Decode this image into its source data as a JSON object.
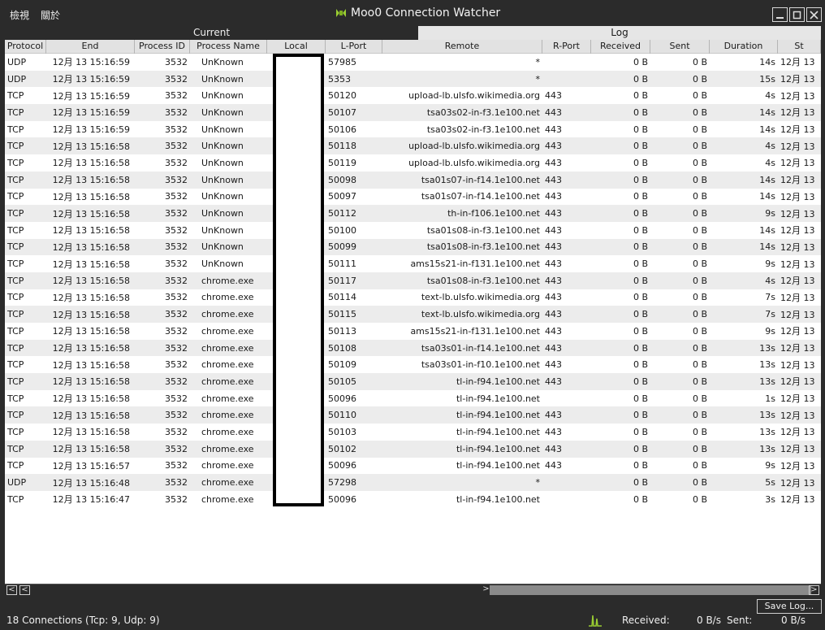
{
  "menu": {
    "view": "檢視",
    "about": "關於"
  },
  "window": {
    "title": "Moo0 Connection Watcher"
  },
  "tabs": {
    "current": "Current",
    "log": "Log"
  },
  "columns": [
    "Protocol",
    "End",
    "Process ID",
    "Process Name",
    "Local",
    "L-Port",
    "Remote",
    "R-Port",
    "Received",
    "Sent",
    "Duration",
    "St"
  ],
  "rows": [
    [
      "UDP",
      "12月 13  15:16:59",
      "3532",
      "UnKnown",
      "",
      "57985",
      "*",
      "",
      "0 B",
      "0 B",
      "14s",
      "12月 13"
    ],
    [
      "UDP",
      "12月 13  15:16:59",
      "3532",
      "UnKnown",
      "",
      "5353",
      "*",
      "",
      "0 B",
      "0 B",
      "15s",
      "12月 13"
    ],
    [
      "TCP",
      "12月 13  15:16:59",
      "3532",
      "UnKnown",
      "",
      "50120",
      "upload-lb.ulsfo.wikimedia.org",
      "443",
      "0 B",
      "0 B",
      "4s",
      "12月 13"
    ],
    [
      "TCP",
      "12月 13  15:16:59",
      "3532",
      "UnKnown",
      "",
      "50107",
      "tsa03s02-in-f3.1e100.net",
      "443",
      "0 B",
      "0 B",
      "14s",
      "12月 13"
    ],
    [
      "TCP",
      "12月 13  15:16:59",
      "3532",
      "UnKnown",
      "",
      "50106",
      "tsa03s02-in-f3.1e100.net",
      "443",
      "0 B",
      "0 B",
      "14s",
      "12月 13"
    ],
    [
      "TCP",
      "12月 13  15:16:58",
      "3532",
      "UnKnown",
      "",
      "50118",
      "upload-lb.ulsfo.wikimedia.org",
      "443",
      "0 B",
      "0 B",
      "4s",
      "12月 13"
    ],
    [
      "TCP",
      "12月 13  15:16:58",
      "3532",
      "UnKnown",
      "",
      "50119",
      "upload-lb.ulsfo.wikimedia.org",
      "443",
      "0 B",
      "0 B",
      "4s",
      "12月 13"
    ],
    [
      "TCP",
      "12月 13  15:16:58",
      "3532",
      "UnKnown",
      "",
      "50098",
      "tsa01s07-in-f14.1e100.net",
      "443",
      "0 B",
      "0 B",
      "14s",
      "12月 13"
    ],
    [
      "TCP",
      "12月 13  15:16:58",
      "3532",
      "UnKnown",
      "",
      "50097",
      "tsa01s07-in-f14.1e100.net",
      "443",
      "0 B",
      "0 B",
      "14s",
      "12月 13"
    ],
    [
      "TCP",
      "12月 13  15:16:58",
      "3532",
      "UnKnown",
      "",
      "50112",
      "th-in-f106.1e100.net",
      "443",
      "0 B",
      "0 B",
      "9s",
      "12月 13"
    ],
    [
      "TCP",
      "12月 13  15:16:58",
      "3532",
      "UnKnown",
      "",
      "50100",
      "tsa01s08-in-f3.1e100.net",
      "443",
      "0 B",
      "0 B",
      "14s",
      "12月 13"
    ],
    [
      "TCP",
      "12月 13  15:16:58",
      "3532",
      "UnKnown",
      "",
      "50099",
      "tsa01s08-in-f3.1e100.net",
      "443",
      "0 B",
      "0 B",
      "14s",
      "12月 13"
    ],
    [
      "TCP",
      "12月 13  15:16:58",
      "3532",
      "UnKnown",
      "",
      "50111",
      "ams15s21-in-f131.1e100.net",
      "443",
      "0 B",
      "0 B",
      "9s",
      "12月 13"
    ],
    [
      "TCP",
      "12月 13  15:16:58",
      "3532",
      "chrome.exe",
      "",
      "50117",
      "tsa01s08-in-f3.1e100.net",
      "443",
      "0 B",
      "0 B",
      "4s",
      "12月 13"
    ],
    [
      "TCP",
      "12月 13  15:16:58",
      "3532",
      "chrome.exe",
      "",
      "50114",
      "text-lb.ulsfo.wikimedia.org",
      "443",
      "0 B",
      "0 B",
      "7s",
      "12月 13"
    ],
    [
      "TCP",
      "12月 13  15:16:58",
      "3532",
      "chrome.exe",
      "",
      "50115",
      "text-lb.ulsfo.wikimedia.org",
      "443",
      "0 B",
      "0 B",
      "7s",
      "12月 13"
    ],
    [
      "TCP",
      "12月 13  15:16:58",
      "3532",
      "chrome.exe",
      "",
      "50113",
      "ams15s21-in-f131.1e100.net",
      "443",
      "0 B",
      "0 B",
      "9s",
      "12月 13"
    ],
    [
      "TCP",
      "12月 13  15:16:58",
      "3532",
      "chrome.exe",
      "",
      "50108",
      "tsa03s01-in-f14.1e100.net",
      "443",
      "0 B",
      "0 B",
      "13s",
      "12月 13"
    ],
    [
      "TCP",
      "12月 13  15:16:58",
      "3532",
      "chrome.exe",
      "",
      "50109",
      "tsa03s01-in-f10.1e100.net",
      "443",
      "0 B",
      "0 B",
      "13s",
      "12月 13"
    ],
    [
      "TCP",
      "12月 13  15:16:58",
      "3532",
      "chrome.exe",
      "",
      "50105",
      "tl-in-f94.1e100.net",
      "443",
      "0 B",
      "0 B",
      "13s",
      "12月 13"
    ],
    [
      "TCP",
      "12月 13  15:16:58",
      "3532",
      "chrome.exe",
      "",
      "50096",
      "tl-in-f94.1e100.net",
      "",
      "0 B",
      "0 B",
      "1s",
      "12月 13"
    ],
    [
      "TCP",
      "12月 13  15:16:58",
      "3532",
      "chrome.exe",
      "",
      "50110",
      "tl-in-f94.1e100.net",
      "443",
      "0 B",
      "0 B",
      "13s",
      "12月 13"
    ],
    [
      "TCP",
      "12月 13  15:16:58",
      "3532",
      "chrome.exe",
      "",
      "50103",
      "tl-in-f94.1e100.net",
      "443",
      "0 B",
      "0 B",
      "13s",
      "12月 13"
    ],
    [
      "TCP",
      "12月 13  15:16:58",
      "3532",
      "chrome.exe",
      "",
      "50102",
      "tl-in-f94.1e100.net",
      "443",
      "0 B",
      "0 B",
      "13s",
      "12月 13"
    ],
    [
      "TCP",
      "12月 13  15:16:57",
      "3532",
      "chrome.exe",
      "",
      "50096",
      "tl-in-f94.1e100.net",
      "443",
      "0 B",
      "0 B",
      "9s",
      "12月 13"
    ],
    [
      "UDP",
      "12月 13  15:16:48",
      "3532",
      "chrome.exe",
      "",
      "57298",
      "*",
      "",
      "0 B",
      "0 B",
      "5s",
      "12月 13"
    ],
    [
      "TCP",
      "12月 13  15:16:47",
      "3532",
      "chrome.exe",
      "",
      "50096",
      "tl-in-f94.1e100.net",
      "",
      "0 B",
      "0 B",
      "3s",
      "12月 13"
    ]
  ],
  "status": {
    "connections": "18 Connections (Tcp: 9, Udp: 9)",
    "save_log": "Save Log...",
    "received_label": "Received:",
    "received_value": "0 B/s",
    "sent_label": "Sent:",
    "sent_value": "0 B/s"
  },
  "icons": {
    "logo": "moo0-logo-icon",
    "graph": "traffic-graph-icon"
  },
  "colors": {
    "chrome": "#2b2b2b",
    "log_tab": "#e6e6e6",
    "accent": "#9acd32"
  }
}
